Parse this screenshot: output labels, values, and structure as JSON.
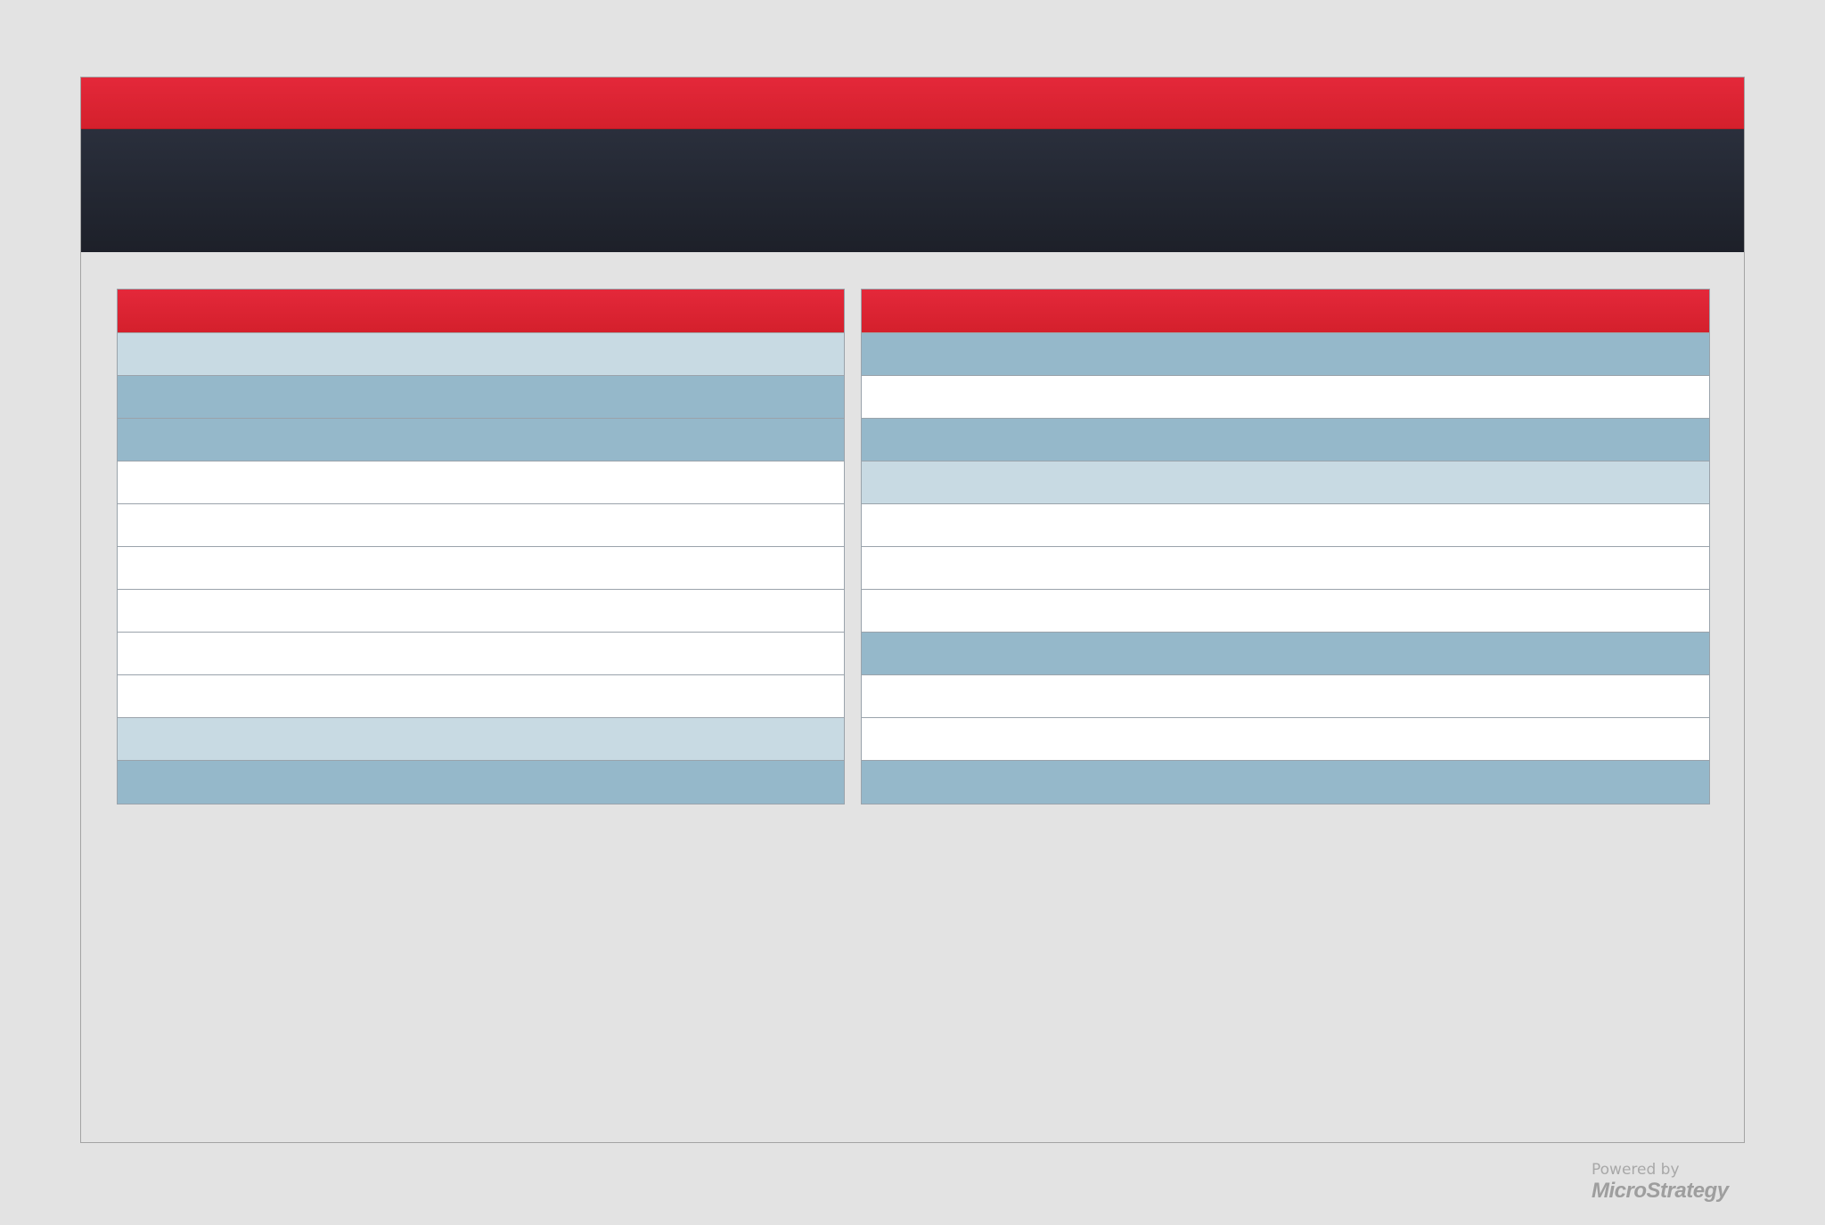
{
  "footer": {
    "powered_by": "Powered by",
    "brand": "MicroStrategy"
  },
  "colors": {
    "background": "#e3e3e3",
    "header_red": "#dc2330",
    "header_dark": "#232733",
    "row_light": "#c8dae3",
    "row_mid": "#95b8ca",
    "row_white": "#ffffff"
  },
  "grids": {
    "left": {
      "rows": [
        "light",
        "mid",
        "mid",
        "white",
        "white",
        "white",
        "white",
        "white",
        "white",
        "light",
        "mid"
      ]
    },
    "right": {
      "rows": [
        "mid",
        "white",
        "mid",
        "light",
        "white",
        "white",
        "white",
        "mid",
        "white",
        "white",
        "mid"
      ]
    }
  }
}
